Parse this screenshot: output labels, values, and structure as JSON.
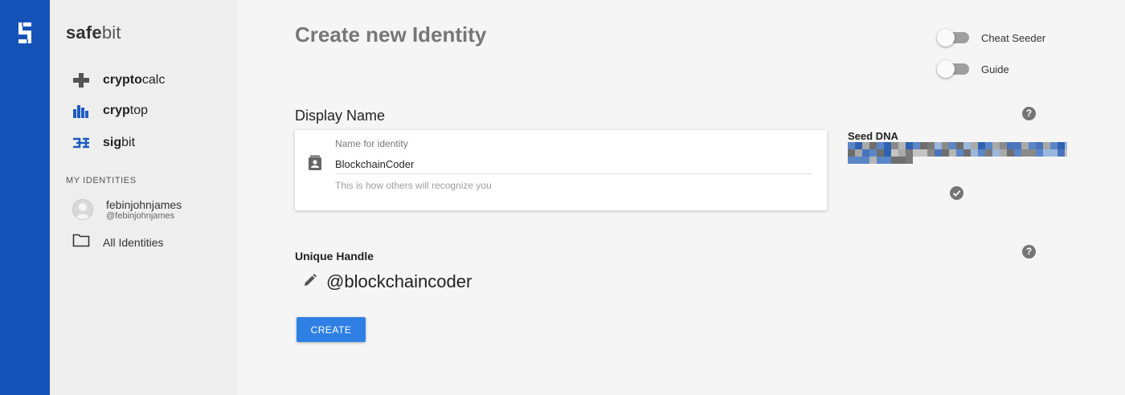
{
  "brand": {
    "bold": "safe",
    "regular": "bit"
  },
  "apps": [
    {
      "bold": "crypto",
      "regular": "calc",
      "icon": "plus-icon"
    },
    {
      "bold": "cryp",
      "regular": "top",
      "icon": "bar-chart-icon"
    },
    {
      "bold": "sig",
      "regular": "bit",
      "icon": "signal-icon"
    }
  ],
  "identities": {
    "section_title": "MY IDENTITIES",
    "items": [
      {
        "name": "febinjohnjames",
        "handle": "@febinjohnjames"
      }
    ],
    "all_label": "All Identities"
  },
  "page": {
    "title": "Create new Identity"
  },
  "toggles": [
    {
      "label": "Cheat Seeder",
      "on": false
    },
    {
      "label": "Guide",
      "on": false
    }
  ],
  "display_name": {
    "section_title": "Display Name",
    "field_label": "Name for identity",
    "value": "BlockchainCoder",
    "hint": "This is how others will recognize you"
  },
  "seed": {
    "title": "Seed DNA"
  },
  "handle": {
    "title": "Unique Handle",
    "value": "@blockchaincoder"
  },
  "create_button": {
    "label": "CREATE"
  },
  "colors": {
    "rail": "#1452b8",
    "button": "#2f80e4",
    "sidebar": "#eeeeee",
    "background": "#f5f5f5"
  }
}
